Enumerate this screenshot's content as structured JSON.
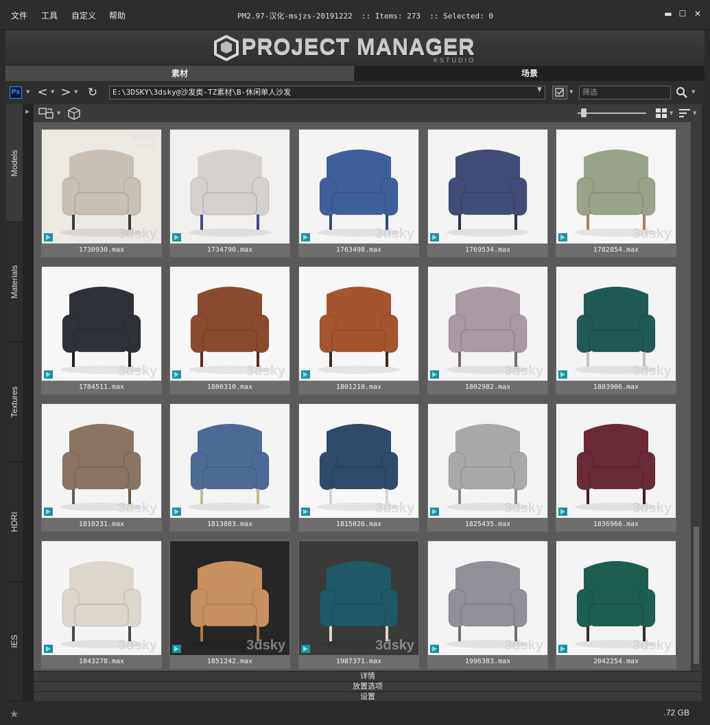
{
  "menu": [
    "文件",
    "工具",
    "自定义",
    "帮助"
  ],
  "title": "PM2.97-汉化-msjzs-20191222  :: Items: 273  :: Selected: 0",
  "window_controls": {
    "close": "✕",
    "maximize": "☐",
    "minimize": "▬"
  },
  "logo": {
    "name": "PROJECT MANAGER",
    "sub": "KSTUDIO"
  },
  "tabs": [
    "素材",
    "场景"
  ],
  "toolbar": {
    "ps_label": "Ps",
    "path": "E:\\3DSKY\\3dsky@沙发类-TZ素材\\B-休闲单人沙发",
    "filter_placeholder": "筛选"
  },
  "side_tabs": [
    "Models",
    "Materials",
    "Textures",
    "HDRI",
    "IES"
  ],
  "items": [
    {
      "name": "1730930.max",
      "brand": "MODA\nPrince",
      "watermark": "3dsky"
    },
    {
      "name": "1734790.max",
      "brand": "",
      "watermark": ""
    },
    {
      "name": "1763498.max",
      "brand": "",
      "watermark": "3dsky"
    },
    {
      "name": "1769534.max",
      "brand": "",
      "watermark": ""
    },
    {
      "name": "1782854.max",
      "brand": "",
      "watermark": "3dsky"
    },
    {
      "name": "1784511.max",
      "brand": "",
      "watermark": "3dsky"
    },
    {
      "name": "1800310.max",
      "brand": "",
      "watermark": "3dsky"
    },
    {
      "name": "1801210.max",
      "brand": "",
      "watermark": ""
    },
    {
      "name": "1802982.max",
      "brand": "",
      "watermark": "3dsky"
    },
    {
      "name": "1803906.max",
      "brand": "",
      "watermark": "3dsky"
    },
    {
      "name": "1810231.max",
      "brand": "",
      "watermark": "3dsky"
    },
    {
      "name": "1813883.max",
      "brand": "",
      "watermark": ""
    },
    {
      "name": "1815026.max",
      "brand": "",
      "watermark": "3dsky"
    },
    {
      "name": "1825435.max",
      "brand": "",
      "watermark": "3dsky"
    },
    {
      "name": "1836966.max",
      "brand": "",
      "watermark": "3dsky"
    },
    {
      "name": "1843278.max",
      "brand": "",
      "watermark": "3dsky"
    },
    {
      "name": "1851242.max",
      "brand": "",
      "watermark": "3dsky"
    },
    {
      "name": "1987371.max",
      "brand": "",
      "watermark": "3dsky"
    },
    {
      "name": "1996383.max",
      "brand": "",
      "watermark": "3dsky"
    },
    {
      "name": "2042254.max",
      "brand": "",
      "watermark": "3dsky"
    }
  ],
  "panels": [
    "详情",
    "放置选项",
    "设置"
  ],
  "status": {
    "disk": ".72 GB"
  },
  "colors": {
    "bg": "#2b2b2b",
    "grid": "#5a5a5a",
    "card": "#6d6d6d",
    "accent": "#1f8fa3"
  }
}
